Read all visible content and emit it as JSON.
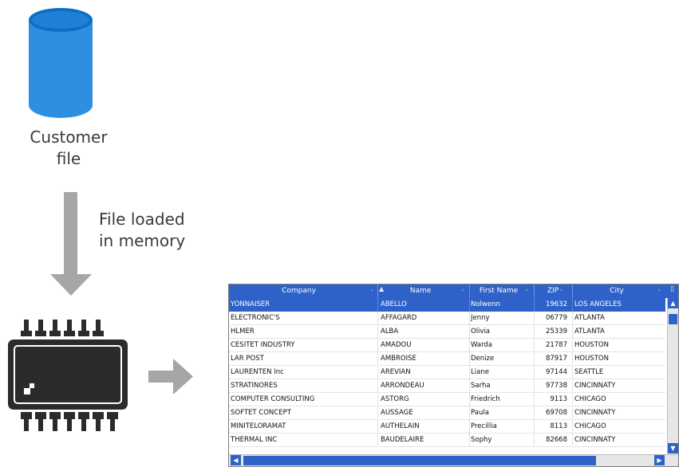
{
  "customer_file": {
    "line1": "Customer",
    "line2": "file"
  },
  "load_arrow_label": {
    "line1": "File loaded",
    "line2": "in memory"
  },
  "colors": {
    "cylinder": "#2e8fe0",
    "arrow": "#a6a6a6",
    "chip": "#2b2b2b",
    "grid_accent": "#2e62c8"
  },
  "icons": {
    "storage": "database-cylinder-icon",
    "memory": "memory-chip-icon"
  },
  "grid": {
    "columns": [
      "Company",
      "Name",
      "First Name",
      "ZIP",
      "City"
    ],
    "rows": [
      [
        "YONNAISER",
        "ABELLO",
        "Nolwenn",
        "19632",
        "LOS ANGELES"
      ],
      [
        "ELECTRONIC'S",
        "AFFAGARD",
        "Jenny",
        "06779",
        "ATLANTA"
      ],
      [
        "HLMER",
        "ALBA",
        "Olivia",
        "25339",
        "ATLANTA"
      ],
      [
        "CESITET INDUSTRY",
        "AMADOU",
        "Warda",
        "21787",
        "HOUSTON"
      ],
      [
        "LAR POST",
        "AMBROISE",
        "Denize",
        "87917",
        "HOUSTON"
      ],
      [
        "LAURENTEN Inc",
        "AREVIAN",
        "Liane",
        "97144",
        "SEATTLE"
      ],
      [
        "STRATINORES",
        "ARRONDEAU",
        "Sarha",
        "97738",
        "CINCINNATY"
      ],
      [
        "COMPUTER CONSULTING",
        "ASTORG",
        "Friedrich",
        "9113",
        "CHICAGO"
      ],
      [
        "SOFTET CONCEPT",
        "AUSSAGE",
        "Paula",
        "69708",
        "CINCINNATY"
      ],
      [
        "MINITELORAMAT",
        "AUTHELAIN",
        "Precillia",
        "8113",
        "CHICAGO"
      ],
      [
        "THERMAL INC",
        "BAUDELAIRE",
        "Sophy",
        "82668",
        "CINCINNATY"
      ]
    ],
    "selected_row": 0
  }
}
